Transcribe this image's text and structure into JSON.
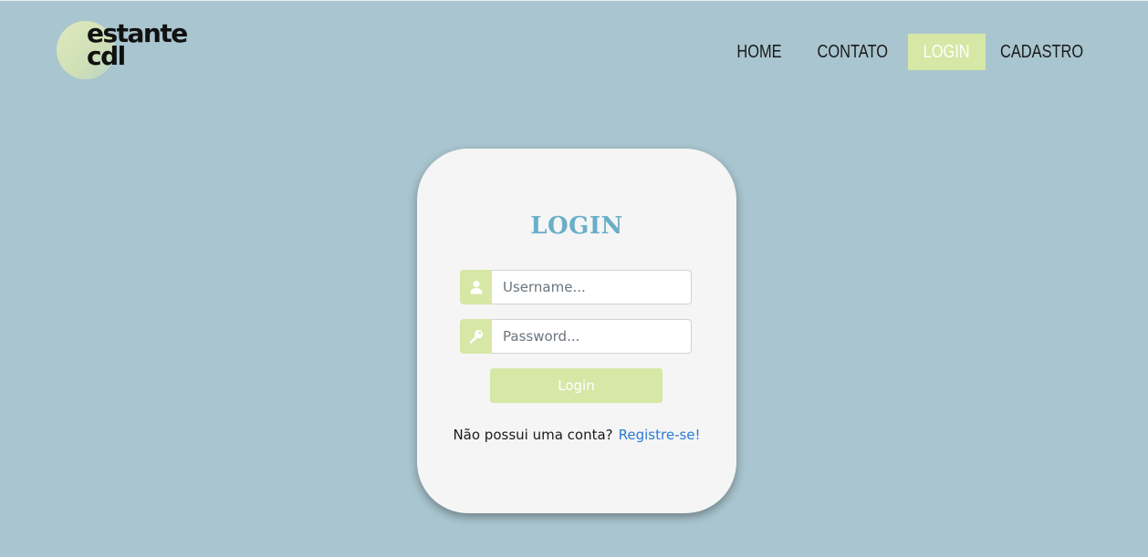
{
  "brand": {
    "logo_line1": "estante",
    "logo_line2": "cdl"
  },
  "nav": {
    "items": [
      {
        "label": "HOME",
        "active": false
      },
      {
        "label": "CONTATO",
        "active": false
      },
      {
        "label": "LOGIN",
        "active": true
      },
      {
        "label": "CADASTRO",
        "active": false
      }
    ]
  },
  "login_form": {
    "title": "LOGIN",
    "username": {
      "value": "",
      "placeholder": "Username...",
      "icon": "user-icon"
    },
    "password": {
      "value": "",
      "placeholder": "Password...",
      "icon": "key-icon"
    },
    "submit_label": "Login",
    "register_prompt": "Não possui uma conta?",
    "register_link": "Registre-se!"
  },
  "colors": {
    "background": "#a9c5cf",
    "accent": "#d6e7a6",
    "title": "#6aaec8",
    "link": "#2a7bd4",
    "card": "#f5f5f5"
  }
}
